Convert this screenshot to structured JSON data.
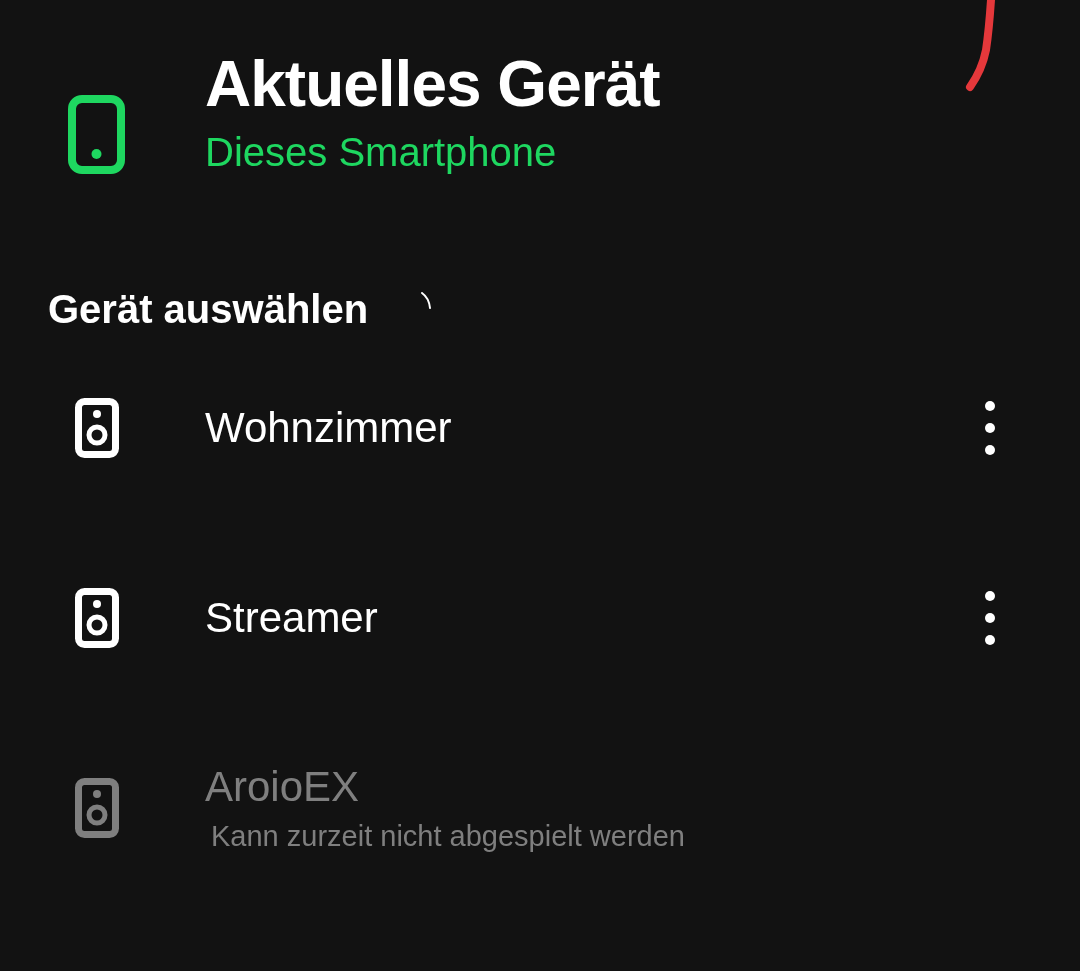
{
  "current_device": {
    "title": "Aktuelles Gerät",
    "subtitle": "Dieses Smartphone"
  },
  "device_picker": {
    "heading": "Gerät auswählen",
    "loading": true,
    "devices": [
      {
        "name": "Wohnzimmer",
        "disabled": false,
        "menu": true
      },
      {
        "name": "Streamer",
        "disabled": false,
        "menu": true
      },
      {
        "name": "AroioEX",
        "disabled": true,
        "menu": false,
        "status": "Kann zurzeit nicht abgespielt werden"
      }
    ]
  }
}
